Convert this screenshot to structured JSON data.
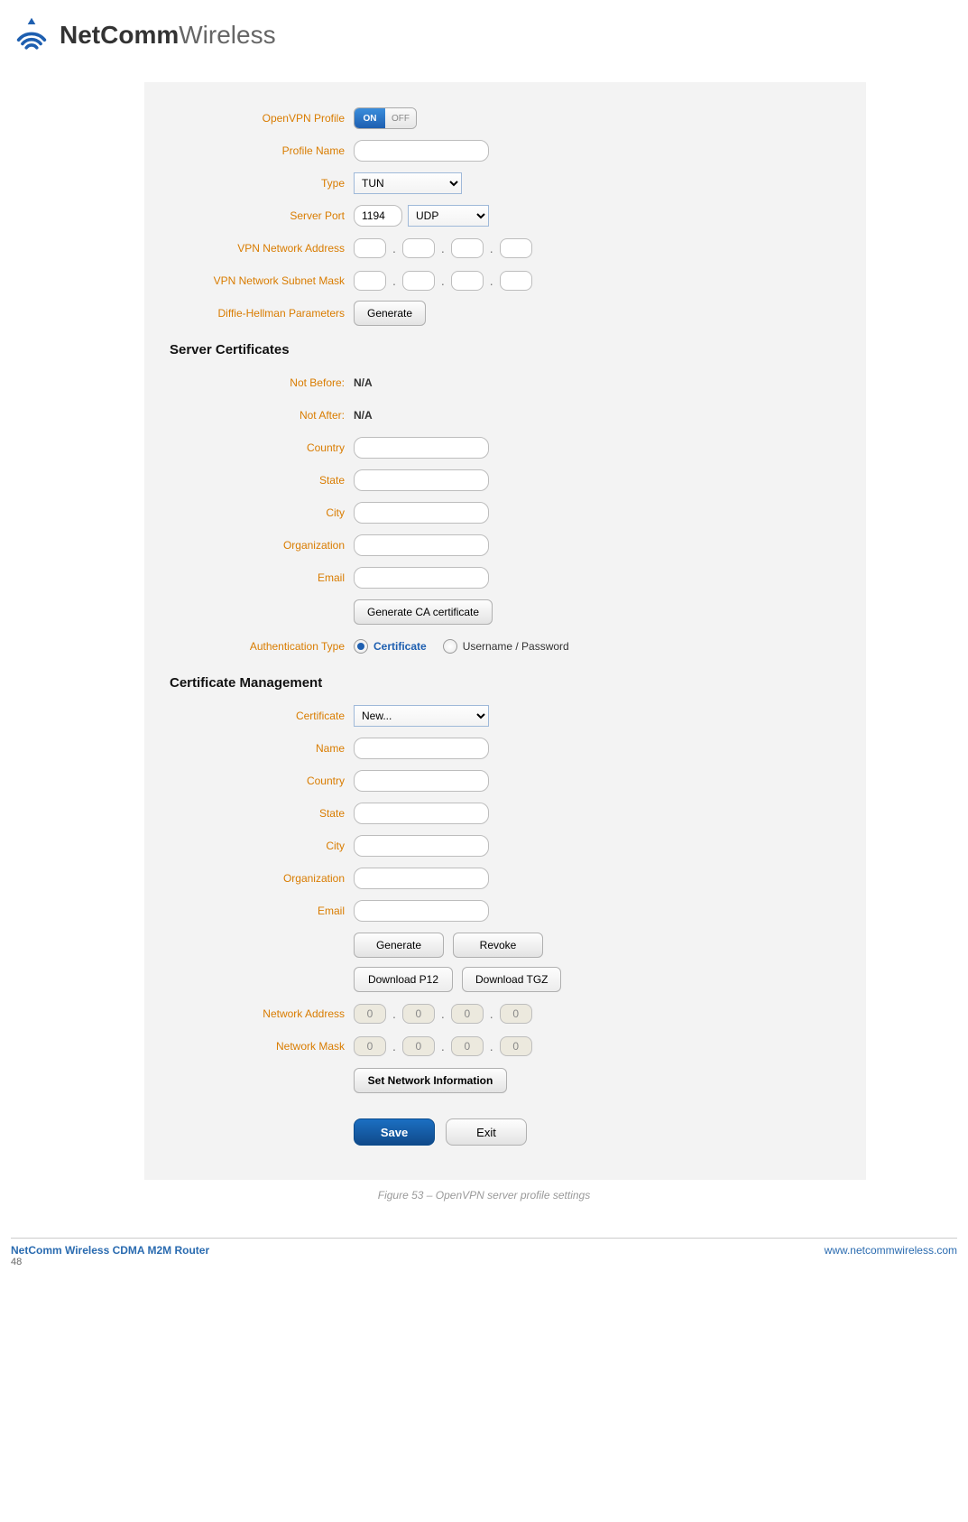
{
  "brand": {
    "strong": "NetComm",
    "light": "Wireless"
  },
  "form": {
    "openvpn_profile": {
      "label": "OpenVPN Profile",
      "on": "ON",
      "off": "OFF",
      "state": "on"
    },
    "profile_name": {
      "label": "Profile Name",
      "value": ""
    },
    "type": {
      "label": "Type",
      "value": "TUN"
    },
    "server_port": {
      "label": "Server Port",
      "value": "1194",
      "proto": "UDP"
    },
    "vpn_net_addr": {
      "label": "VPN Network Address",
      "o1": "",
      "o2": "",
      "o3": "",
      "o4": ""
    },
    "vpn_net_mask": {
      "label": "VPN Network Subnet Mask",
      "o1": "",
      "o2": "",
      "o3": "",
      "o4": ""
    },
    "dh": {
      "label": "Diffie-Hellman Parameters",
      "button": "Generate"
    }
  },
  "server_cert_title": "Server Certificates",
  "server_cert": {
    "not_before": {
      "label": "Not Before:",
      "value": "N/A"
    },
    "not_after": {
      "label": "Not After:",
      "value": "N/A"
    },
    "country": {
      "label": "Country",
      "value": ""
    },
    "state": {
      "label": "State",
      "value": ""
    },
    "city": {
      "label": "City",
      "value": ""
    },
    "org": {
      "label": "Organization",
      "value": ""
    },
    "email": {
      "label": "Email",
      "value": ""
    },
    "gen_ca": "Generate CA certificate",
    "auth_type": {
      "label": "Authentication Type",
      "opt_cert": "Certificate",
      "opt_userpass": "Username / Password",
      "selected": "cert"
    }
  },
  "cert_mgmt_title": "Certificate Management",
  "cert_mgmt": {
    "certificate": {
      "label": "Certificate",
      "value": "New..."
    },
    "name": {
      "label": "Name",
      "value": ""
    },
    "country": {
      "label": "Country",
      "value": ""
    },
    "state": {
      "label": "State",
      "value": ""
    },
    "city": {
      "label": "City",
      "value": ""
    },
    "org": {
      "label": "Organization",
      "value": ""
    },
    "email": {
      "label": "Email",
      "value": ""
    },
    "btn_generate": "Generate",
    "btn_revoke": "Revoke",
    "btn_dl_p12": "Download P12",
    "btn_dl_tgz": "Download TGZ",
    "net_addr": {
      "label": "Network Address",
      "o1": "0",
      "o2": "0",
      "o3": "0",
      "o4": "0"
    },
    "net_mask": {
      "label": "Network Mask",
      "o1": "0",
      "o2": "0",
      "o3": "0",
      "o4": "0"
    },
    "btn_set_net": "Set Network Information",
    "btn_save": "Save",
    "btn_exit": "Exit"
  },
  "caption": "Figure 53 – OpenVPN server profile settings",
  "footer": {
    "product": "NetComm Wireless CDMA M2M Router",
    "page": "48",
    "url": "www.netcommwireless.com"
  }
}
